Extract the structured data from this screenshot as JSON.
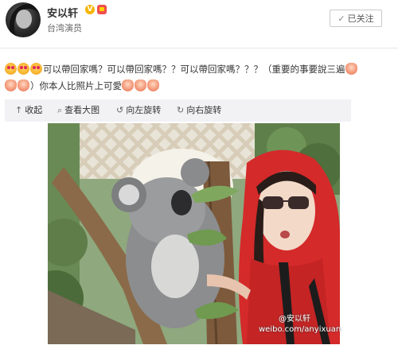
{
  "profile": {
    "name": "安以轩",
    "verified_badge": "V",
    "verification": "台湾演员",
    "follow_label": "已关注",
    "follow_check": "✓"
  },
  "post": {
    "text": "可以帶回家嗎？可以帶回家嗎？？可以帶回家嗎？？？（重要的事要說三遍",
    "text2": "）你本人比照片上可愛"
  },
  "toolbar": {
    "collapse_label": "收起",
    "view_large_label": "查看大图",
    "rotate_left_label": "向左旋转",
    "rotate_right_label": "向右旋转"
  },
  "photo": {
    "watermark_url": "weibo.com/anyixuan",
    "watermark_handle": "@安以轩"
  },
  "colors": {
    "hoodie": "#d42a2a",
    "badge_v": "#f7b500",
    "toolbar_bg": "#f2f2f5"
  }
}
